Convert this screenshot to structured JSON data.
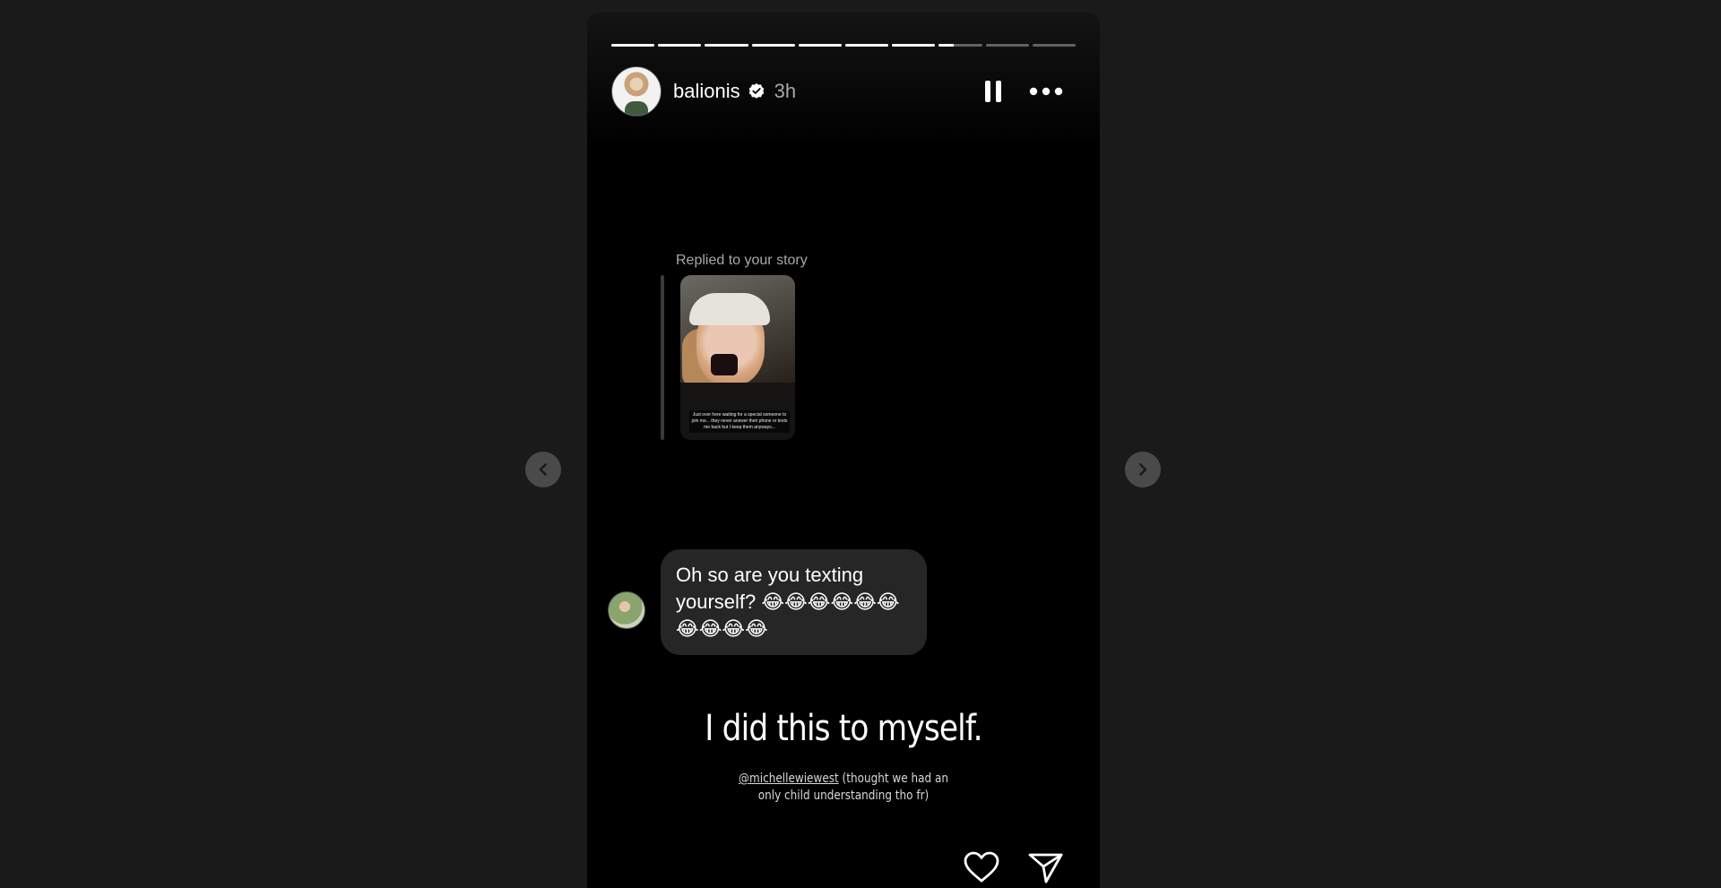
{
  "story": {
    "progress": {
      "segment_count": 10,
      "current_index": 7,
      "current_fraction": 0.35
    },
    "header": {
      "username": "balionis",
      "verified": true,
      "time": "3h",
      "avatar_icon": "user-avatar",
      "pause_icon": "pause-icon",
      "more_icon": "more-options-icon"
    },
    "reply": {
      "label": "Replied to your story",
      "thumbnail_caption": "Just over here waiting for a special someone to join me... they never answer their phone or texts me back but I keep them anyways..."
    },
    "message": {
      "text": "Oh so are you texting yourself? 😂😂😂😂😂😂😂😂😂😂"
    },
    "caption": {
      "headline": "I did this to myself.",
      "mention": "@michellewiewest",
      "subtext_line1": " (thought we had an",
      "subtext_line2": "only child understanding tho fr)"
    },
    "footer": {
      "like_icon": "heart-icon",
      "share_icon": "send-icon"
    }
  },
  "navigation": {
    "prev_icon": "chevron-left-icon",
    "next_icon": "chevron-right-icon"
  }
}
